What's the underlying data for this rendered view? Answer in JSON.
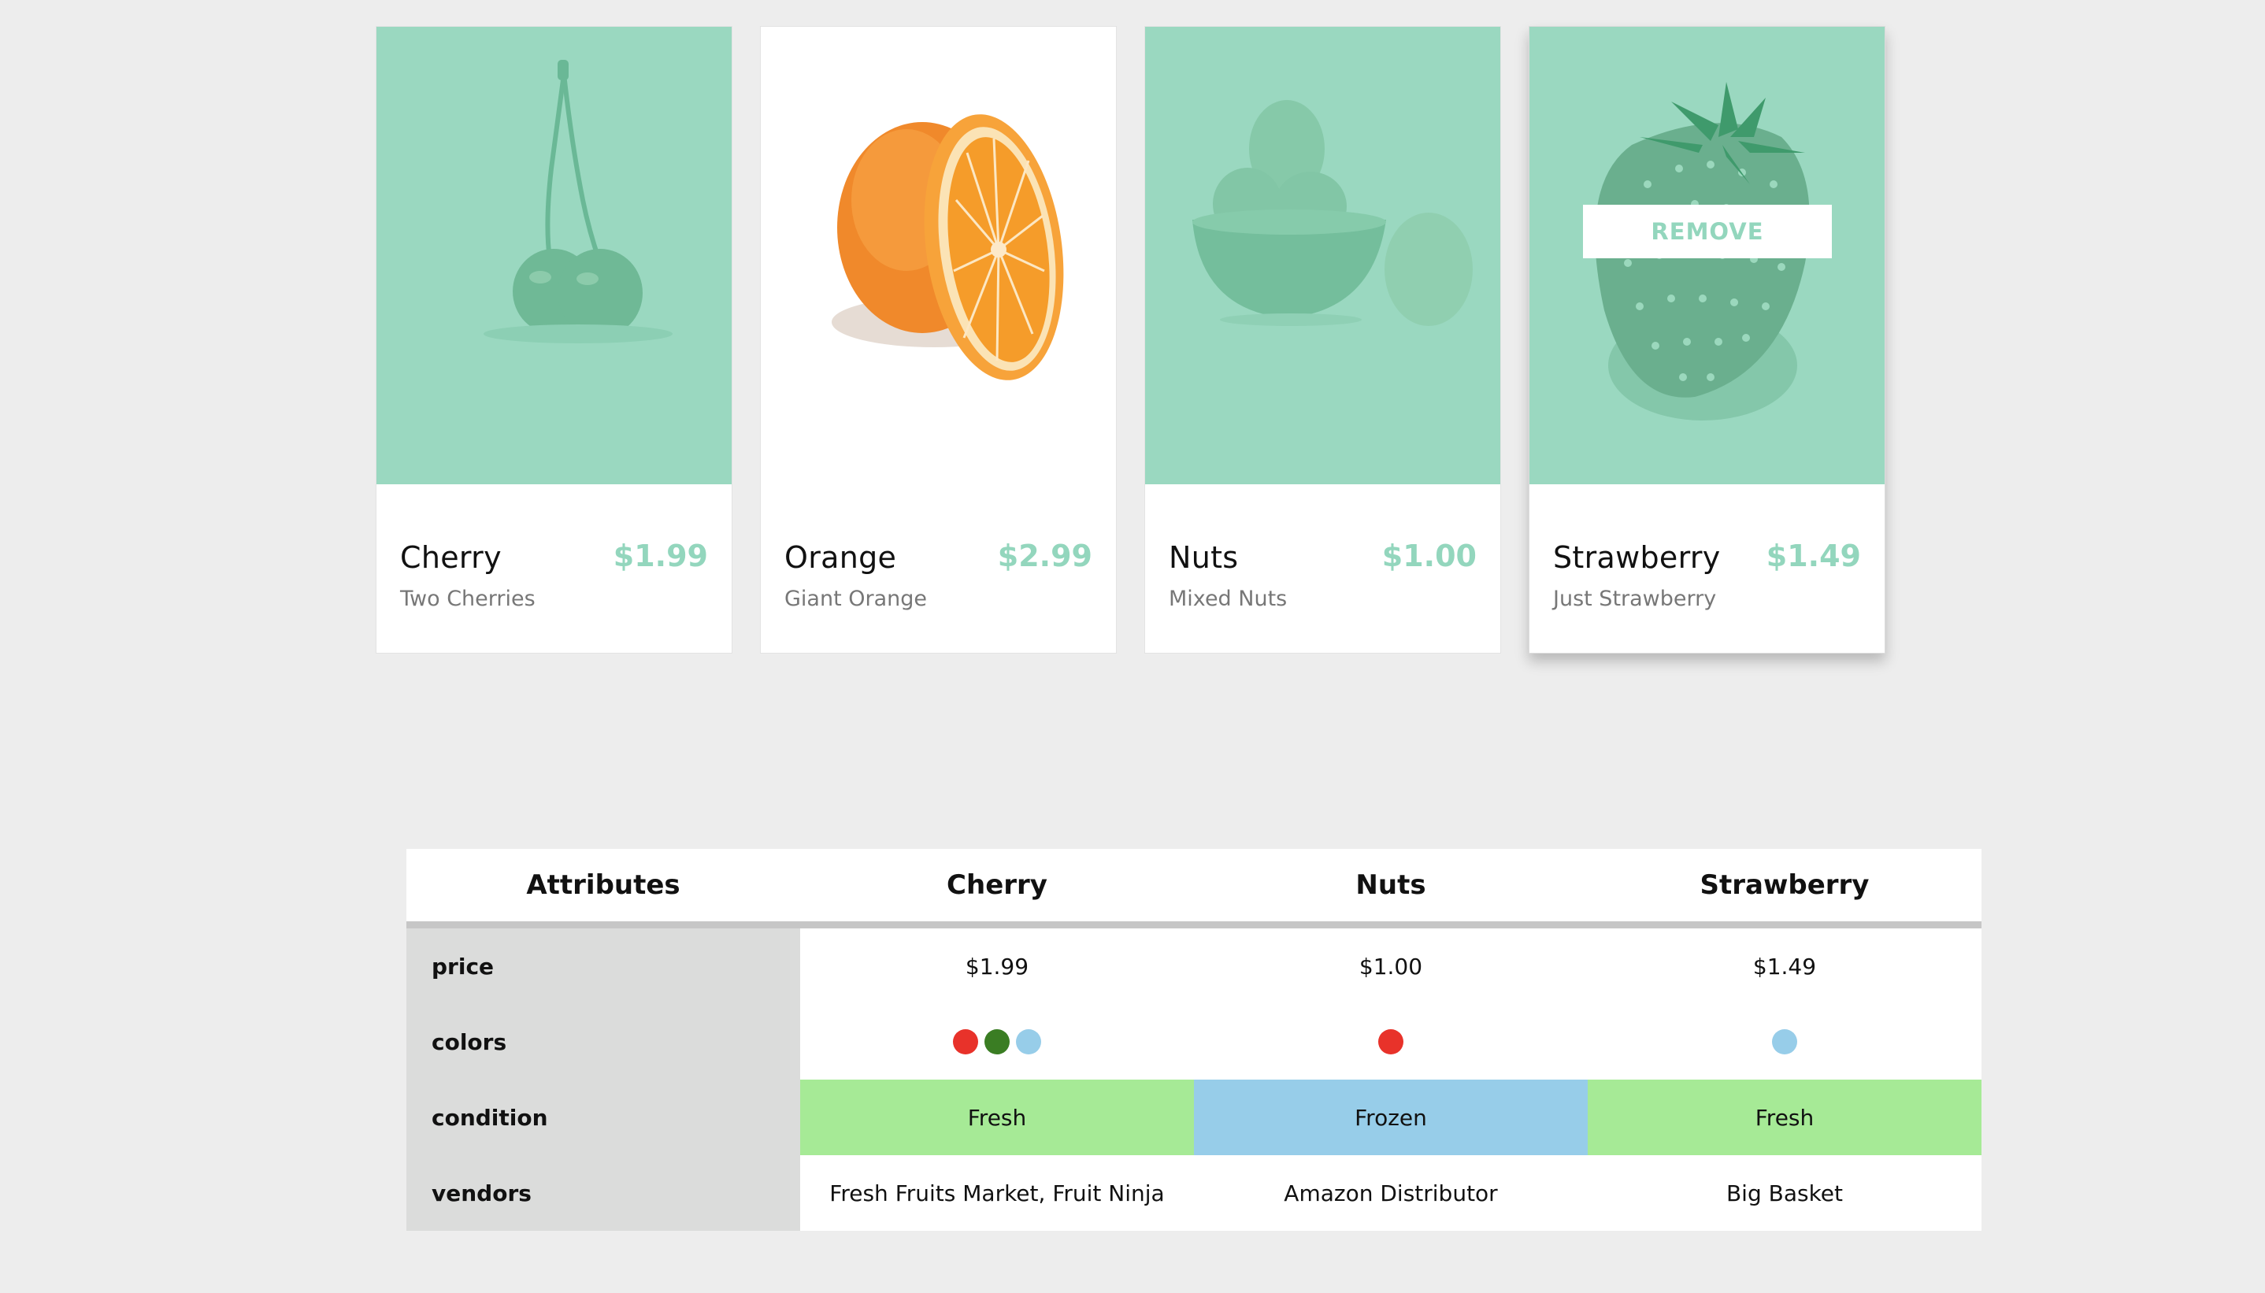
{
  "products": [
    {
      "name": "Cherry",
      "description": "Two Cherries",
      "price": "$1.99",
      "selected": true,
      "image": "cherry"
    },
    {
      "name": "Orange",
      "description": "Giant Orange",
      "price": "$2.99",
      "selected": false,
      "image": "orange"
    },
    {
      "name": "Nuts",
      "description": "Mixed Nuts",
      "price": "$1.00",
      "selected": true,
      "image": "nuts"
    },
    {
      "name": "Strawberry",
      "description": "Just Strawberry",
      "price": "$1.49",
      "selected": true,
      "image": "strawberry",
      "remove_label": "REMOVE"
    }
  ],
  "compare": {
    "headers": [
      "Attributes",
      "Cherry",
      "Nuts",
      "Strawberry"
    ],
    "rows": {
      "price": {
        "label": "price",
        "values": [
          "$1.99",
          "$1.00",
          "$1.49"
        ]
      },
      "colors": {
        "label": "colors",
        "values": [
          [
            "#e8322a",
            "#3a7d23",
            "#97cde9"
          ],
          [
            "#e8322a"
          ],
          [
            "#97cde9"
          ]
        ]
      },
      "condition": {
        "label": "condition",
        "values": [
          "Fresh",
          "Frozen",
          "Fresh"
        ]
      },
      "vendors": {
        "label": "vendors",
        "values": [
          "Fresh Fruits Market, Fruit Ninja",
          "Amazon Distributor",
          "Big Basket"
        ]
      }
    }
  },
  "colors": {
    "accent": "#93d6bd",
    "selected_overlay": "#9ad8c0",
    "fresh": "#a6ea96",
    "frozen": "#97cde9",
    "attribute_column": "#dbdcdb",
    "background": "#ededed"
  }
}
